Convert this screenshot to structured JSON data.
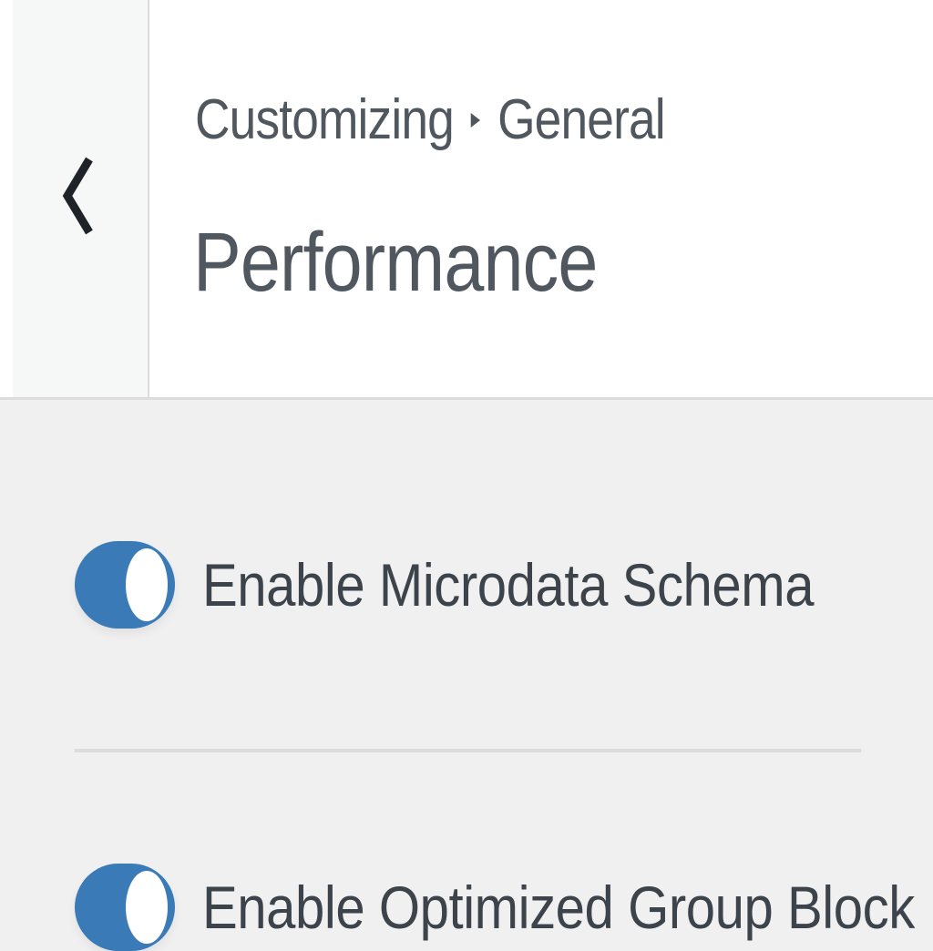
{
  "header": {
    "breadcrumb": {
      "root": "Customizing",
      "section": "General"
    },
    "title": "Performance"
  },
  "settings": [
    {
      "label": "Enable Microdata Schema",
      "enabled": true
    },
    {
      "label": "Enable Optimized Group Block",
      "enabled": true
    }
  ],
  "colors": {
    "toggle_on": "#3a7ab6",
    "header_bg": "#ffffff",
    "panel_bg": "#f0f0f1",
    "text": "#50575e"
  },
  "icons": {
    "back": "chevron-left-icon",
    "breadcrumb_separator": "caret-right-icon"
  }
}
